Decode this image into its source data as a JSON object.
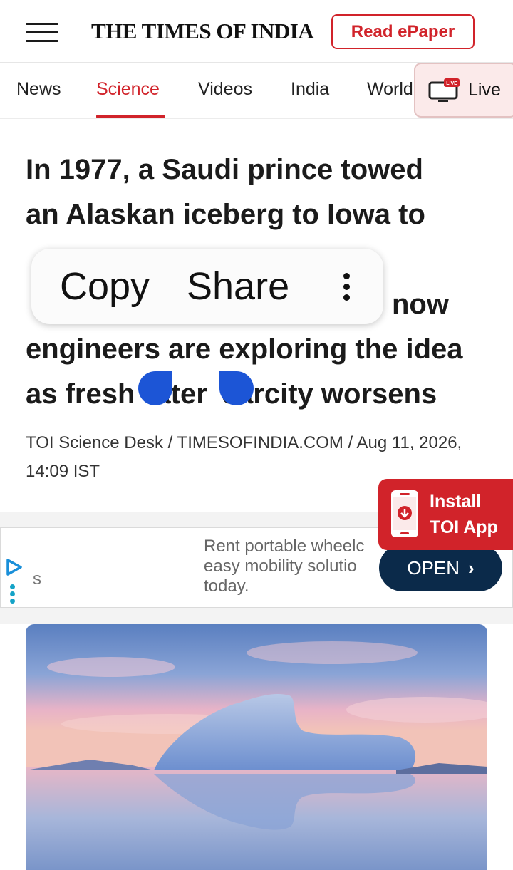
{
  "header": {
    "brand": "THE TIMES OF INDIA",
    "epaper_label": "Read ePaper"
  },
  "nav": {
    "items": [
      {
        "label": "News",
        "active": false
      },
      {
        "label": "Science",
        "active": true
      },
      {
        "label": "Videos",
        "active": false
      },
      {
        "label": "India",
        "active": false
      },
      {
        "label": "World",
        "active": false
      }
    ],
    "live_badge": "LIVE",
    "live_label": "Live"
  },
  "article": {
    "headline_lines": [
      "In 1977, a Saudi prince towed",
      "an Alaskan iceberg to Iowa to",
      "",
      "now",
      "engineers are exploring the idea",
      "as fresh",
      "ater",
      "carcity worsens"
    ],
    "byline": "TOI Science Desk / TIMESOFINDIA.COM / Aug 11, 2026, 14:09 IST"
  },
  "context_menu": {
    "copy": "Copy",
    "share": "Share"
  },
  "ad": {
    "s": "s",
    "text": "Rent portable wheelc\neasy mobility solutio\ntoday.",
    "open": "OPEN",
    "open_icon": "chevron-right-icon"
  },
  "install_banner": {
    "line1": "Install",
    "line2": "TOI App"
  },
  "colors": {
    "accent": "#d1232a",
    "selection_handle": "#1c55d6",
    "ad_button": "#0b2a4a"
  }
}
